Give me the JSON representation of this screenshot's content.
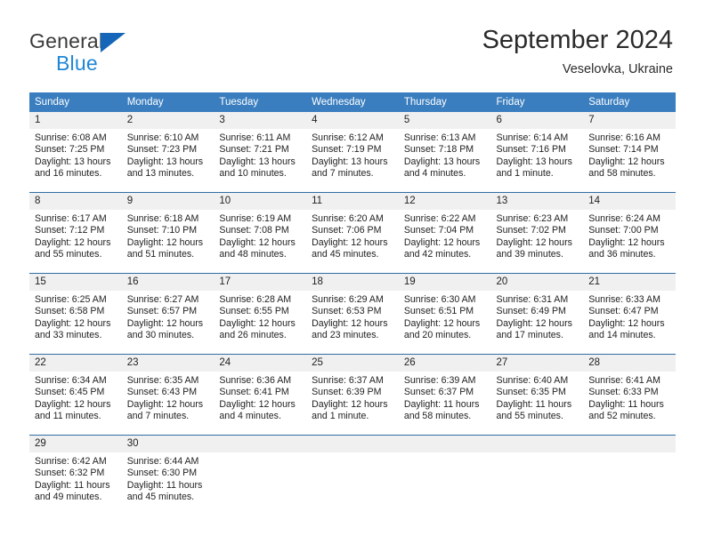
{
  "logo": {
    "primary_text": "General",
    "secondary_text": "Blue",
    "primary_color": "#3a3a3a",
    "secondary_color": "#1e87d6",
    "triangle_color": "#1565b8"
  },
  "header": {
    "title": "September 2024",
    "subtitle": "Veselovka, Ukraine"
  },
  "colors": {
    "header_row_bg": "#3a7ebf",
    "header_row_text": "#ffffff",
    "daynum_bg": "#f0f0f0",
    "row_divider": "#2e6da4",
    "body_text": "#222222"
  },
  "calendar": {
    "weekday_headers": [
      "Sunday",
      "Monday",
      "Tuesday",
      "Wednesday",
      "Thursday",
      "Friday",
      "Saturday"
    ],
    "weeks": [
      [
        {
          "day": "1",
          "sunrise": "Sunrise: 6:08 AM",
          "sunset": "Sunset: 7:25 PM",
          "daylight": "Daylight: 13 hours and 16 minutes."
        },
        {
          "day": "2",
          "sunrise": "Sunrise: 6:10 AM",
          "sunset": "Sunset: 7:23 PM",
          "daylight": "Daylight: 13 hours and 13 minutes."
        },
        {
          "day": "3",
          "sunrise": "Sunrise: 6:11 AM",
          "sunset": "Sunset: 7:21 PM",
          "daylight": "Daylight: 13 hours and 10 minutes."
        },
        {
          "day": "4",
          "sunrise": "Sunrise: 6:12 AM",
          "sunset": "Sunset: 7:19 PM",
          "daylight": "Daylight: 13 hours and 7 minutes."
        },
        {
          "day": "5",
          "sunrise": "Sunrise: 6:13 AM",
          "sunset": "Sunset: 7:18 PM",
          "daylight": "Daylight: 13 hours and 4 minutes."
        },
        {
          "day": "6",
          "sunrise": "Sunrise: 6:14 AM",
          "sunset": "Sunset: 7:16 PM",
          "daylight": "Daylight: 13 hours and 1 minute."
        },
        {
          "day": "7",
          "sunrise": "Sunrise: 6:16 AM",
          "sunset": "Sunset: 7:14 PM",
          "daylight": "Daylight: 12 hours and 58 minutes."
        }
      ],
      [
        {
          "day": "8",
          "sunrise": "Sunrise: 6:17 AM",
          "sunset": "Sunset: 7:12 PM",
          "daylight": "Daylight: 12 hours and 55 minutes."
        },
        {
          "day": "9",
          "sunrise": "Sunrise: 6:18 AM",
          "sunset": "Sunset: 7:10 PM",
          "daylight": "Daylight: 12 hours and 51 minutes."
        },
        {
          "day": "10",
          "sunrise": "Sunrise: 6:19 AM",
          "sunset": "Sunset: 7:08 PM",
          "daylight": "Daylight: 12 hours and 48 minutes."
        },
        {
          "day": "11",
          "sunrise": "Sunrise: 6:20 AM",
          "sunset": "Sunset: 7:06 PM",
          "daylight": "Daylight: 12 hours and 45 minutes."
        },
        {
          "day": "12",
          "sunrise": "Sunrise: 6:22 AM",
          "sunset": "Sunset: 7:04 PM",
          "daylight": "Daylight: 12 hours and 42 minutes."
        },
        {
          "day": "13",
          "sunrise": "Sunrise: 6:23 AM",
          "sunset": "Sunset: 7:02 PM",
          "daylight": "Daylight: 12 hours and 39 minutes."
        },
        {
          "day": "14",
          "sunrise": "Sunrise: 6:24 AM",
          "sunset": "Sunset: 7:00 PM",
          "daylight": "Daylight: 12 hours and 36 minutes."
        }
      ],
      [
        {
          "day": "15",
          "sunrise": "Sunrise: 6:25 AM",
          "sunset": "Sunset: 6:58 PM",
          "daylight": "Daylight: 12 hours and 33 minutes."
        },
        {
          "day": "16",
          "sunrise": "Sunrise: 6:27 AM",
          "sunset": "Sunset: 6:57 PM",
          "daylight": "Daylight: 12 hours and 30 minutes."
        },
        {
          "day": "17",
          "sunrise": "Sunrise: 6:28 AM",
          "sunset": "Sunset: 6:55 PM",
          "daylight": "Daylight: 12 hours and 26 minutes."
        },
        {
          "day": "18",
          "sunrise": "Sunrise: 6:29 AM",
          "sunset": "Sunset: 6:53 PM",
          "daylight": "Daylight: 12 hours and 23 minutes."
        },
        {
          "day": "19",
          "sunrise": "Sunrise: 6:30 AM",
          "sunset": "Sunset: 6:51 PM",
          "daylight": "Daylight: 12 hours and 20 minutes."
        },
        {
          "day": "20",
          "sunrise": "Sunrise: 6:31 AM",
          "sunset": "Sunset: 6:49 PM",
          "daylight": "Daylight: 12 hours and 17 minutes."
        },
        {
          "day": "21",
          "sunrise": "Sunrise: 6:33 AM",
          "sunset": "Sunset: 6:47 PM",
          "daylight": "Daylight: 12 hours and 14 minutes."
        }
      ],
      [
        {
          "day": "22",
          "sunrise": "Sunrise: 6:34 AM",
          "sunset": "Sunset: 6:45 PM",
          "daylight": "Daylight: 12 hours and 11 minutes."
        },
        {
          "day": "23",
          "sunrise": "Sunrise: 6:35 AM",
          "sunset": "Sunset: 6:43 PM",
          "daylight": "Daylight: 12 hours and 7 minutes."
        },
        {
          "day": "24",
          "sunrise": "Sunrise: 6:36 AM",
          "sunset": "Sunset: 6:41 PM",
          "daylight": "Daylight: 12 hours and 4 minutes."
        },
        {
          "day": "25",
          "sunrise": "Sunrise: 6:37 AM",
          "sunset": "Sunset: 6:39 PM",
          "daylight": "Daylight: 12 hours and 1 minute."
        },
        {
          "day": "26",
          "sunrise": "Sunrise: 6:39 AM",
          "sunset": "Sunset: 6:37 PM",
          "daylight": "Daylight: 11 hours and 58 minutes."
        },
        {
          "day": "27",
          "sunrise": "Sunrise: 6:40 AM",
          "sunset": "Sunset: 6:35 PM",
          "daylight": "Daylight: 11 hours and 55 minutes."
        },
        {
          "day": "28",
          "sunrise": "Sunrise: 6:41 AM",
          "sunset": "Sunset: 6:33 PM",
          "daylight": "Daylight: 11 hours and 52 minutes."
        }
      ],
      [
        {
          "day": "29",
          "sunrise": "Sunrise: 6:42 AM",
          "sunset": "Sunset: 6:32 PM",
          "daylight": "Daylight: 11 hours and 49 minutes."
        },
        {
          "day": "30",
          "sunrise": "Sunrise: 6:44 AM",
          "sunset": "Sunset: 6:30 PM",
          "daylight": "Daylight: 11 hours and 45 minutes."
        },
        {
          "day": "",
          "sunrise": "",
          "sunset": "",
          "daylight": ""
        },
        {
          "day": "",
          "sunrise": "",
          "sunset": "",
          "daylight": ""
        },
        {
          "day": "",
          "sunrise": "",
          "sunset": "",
          "daylight": ""
        },
        {
          "day": "",
          "sunrise": "",
          "sunset": "",
          "daylight": ""
        },
        {
          "day": "",
          "sunrise": "",
          "sunset": "",
          "daylight": ""
        }
      ]
    ]
  }
}
